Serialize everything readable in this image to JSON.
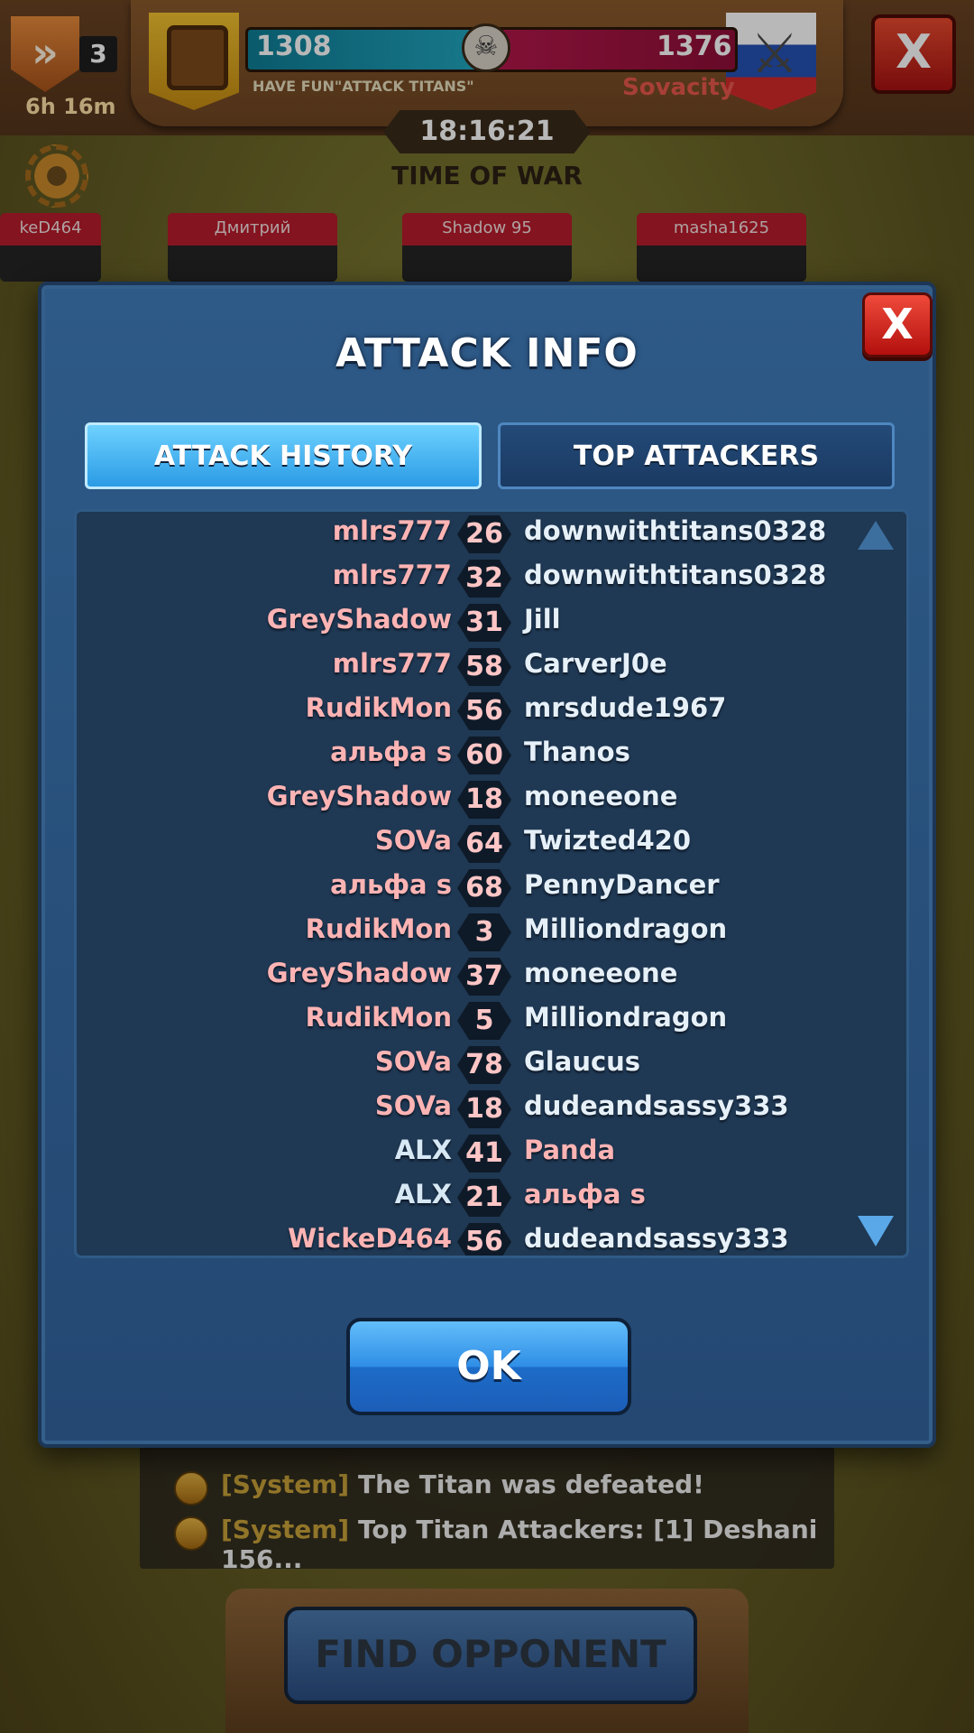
{
  "header": {
    "rank_level": "3",
    "rank_timer": "6h 16m",
    "left_score": "1308",
    "right_score": "1376",
    "left_guild": "HAVE FUN\"ATTACK TITANS\"",
    "right_guild": "Sovacity",
    "war_timer": "18:16:21",
    "war_phase": "TIME OF WAR",
    "close_label": "X"
  },
  "background_cards": [
    {
      "name": "keD464"
    },
    {
      "name": "Дмитрий"
    },
    {
      "name": "Shadow 95"
    },
    {
      "name": "masha1625"
    }
  ],
  "chat": {
    "lines": [
      {
        "tag": "[System]",
        "text": "The Titan was defeated!"
      },
      {
        "tag": "[System]",
        "text": "Top Titan Attackers: [1] Deshani 156..."
      }
    ]
  },
  "find_opponent_label": "FIND OPPONENT",
  "dialog": {
    "title": "ATTACK INFO",
    "close_label": "X",
    "tabs": [
      {
        "label": "ATTACK HISTORY",
        "active": true
      },
      {
        "label": "TOP ATTACKERS",
        "active": false
      }
    ],
    "ok_label": "OK",
    "history": [
      {
        "attacker": "mlrs777",
        "score": "26",
        "target": "downwithtitans0328",
        "attacker_side": "enemy",
        "target_side": "ally"
      },
      {
        "attacker": "mlrs777",
        "score": "32",
        "target": "downwithtitans0328",
        "attacker_side": "enemy",
        "target_side": "ally"
      },
      {
        "attacker": "GreyShadow",
        "score": "31",
        "target": "Jill",
        "attacker_side": "enemy",
        "target_side": "ally"
      },
      {
        "attacker": "mlrs777",
        "score": "58",
        "target": "CarverJ0e",
        "attacker_side": "enemy",
        "target_side": "ally"
      },
      {
        "attacker": "RudikMon",
        "score": "56",
        "target": "mrsdude1967",
        "attacker_side": "enemy",
        "target_side": "ally"
      },
      {
        "attacker": "альфа s",
        "score": "60",
        "target": "Thanos",
        "attacker_side": "enemy",
        "target_side": "ally"
      },
      {
        "attacker": "GreyShadow",
        "score": "18",
        "target": "moneeone",
        "attacker_side": "enemy",
        "target_side": "ally"
      },
      {
        "attacker": "SOVa",
        "score": "64",
        "target": "Twizted420",
        "attacker_side": "enemy",
        "target_side": "ally"
      },
      {
        "attacker": "альфа s",
        "score": "68",
        "target": "PennyDancer",
        "attacker_side": "enemy",
        "target_side": "ally"
      },
      {
        "attacker": "RudikMon",
        "score": "3",
        "target": "Milliondragon",
        "attacker_side": "enemy",
        "target_side": "ally"
      },
      {
        "attacker": "GreyShadow",
        "score": "37",
        "target": "moneeone",
        "attacker_side": "enemy",
        "target_side": "ally"
      },
      {
        "attacker": "RudikMon",
        "score": "5",
        "target": "Milliondragon",
        "attacker_side": "enemy",
        "target_side": "ally"
      },
      {
        "attacker": "SOVa",
        "score": "78",
        "target": "Glaucus",
        "attacker_side": "enemy",
        "target_side": "ally"
      },
      {
        "attacker": "SOVa",
        "score": "18",
        "target": "dudeandsassy333",
        "attacker_side": "enemy",
        "target_side": "ally"
      },
      {
        "attacker": "ALX",
        "score": "41",
        "target": "Panda",
        "attacker_side": "ally",
        "target_side": "enemy"
      },
      {
        "attacker": "ALX",
        "score": "21",
        "target": "альфа s",
        "attacker_side": "ally",
        "target_side": "enemy"
      },
      {
        "attacker": "WickeD464",
        "score": "56",
        "target": "dudeandsassy333",
        "attacker_side": "enemy",
        "target_side": "ally"
      }
    ]
  },
  "colors": {
    "enemy_name": "#ffb4b4",
    "ally_name": "#e6f0f8",
    "dialog_bg": "#28507b",
    "active_tab": "#2b9be5"
  }
}
